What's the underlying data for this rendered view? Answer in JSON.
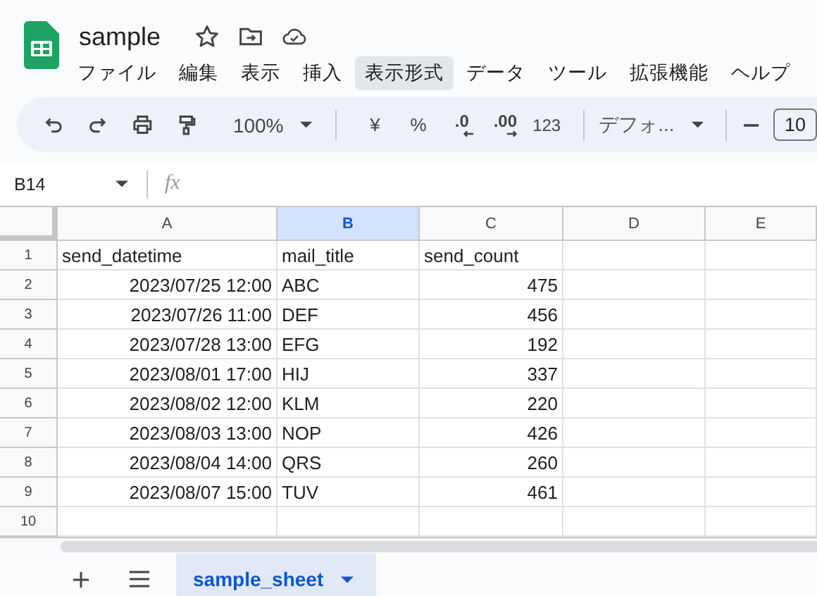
{
  "document": {
    "title": "sample"
  },
  "menu": [
    {
      "label": "ファイル",
      "highlighted": false
    },
    {
      "label": "編集",
      "highlighted": false
    },
    {
      "label": "表示",
      "highlighted": false
    },
    {
      "label": "挿入",
      "highlighted": false
    },
    {
      "label": "表示形式",
      "highlighted": true
    },
    {
      "label": "データ",
      "highlighted": false
    },
    {
      "label": "ツール",
      "highlighted": false
    },
    {
      "label": "拡張機能",
      "highlighted": false
    },
    {
      "label": "ヘルプ",
      "highlighted": false
    }
  ],
  "toolbar": {
    "zoom": "100%",
    "currency": "¥",
    "percent": "%",
    "decrease_decimals": ".0",
    "increase_decimals": ".00",
    "number_format": "123",
    "font": "デフォ...",
    "font_size": "10"
  },
  "formula_bar": {
    "cell_ref": "B14",
    "fx": "fx"
  },
  "columns": [
    {
      "label": "A",
      "selected": false
    },
    {
      "label": "B",
      "selected": true
    },
    {
      "label": "C",
      "selected": false
    },
    {
      "label": "D",
      "selected": false
    },
    {
      "label": "E",
      "selected": false
    }
  ],
  "rows": [
    {
      "number": "1",
      "cells": [
        {
          "text": "send_datetime",
          "kind": "text"
        },
        {
          "text": "mail_title",
          "kind": "text"
        },
        {
          "text": "send_count",
          "kind": "text"
        }
      ]
    },
    {
      "number": "2",
      "cells": [
        {
          "text": "2023/07/25 12:00",
          "kind": "number"
        },
        {
          "text": "ABC",
          "kind": "text"
        },
        {
          "text": "475",
          "kind": "number"
        }
      ]
    },
    {
      "number": "3",
      "cells": [
        {
          "text": "2023/07/26 11:00",
          "kind": "number"
        },
        {
          "text": "DEF",
          "kind": "text"
        },
        {
          "text": "456",
          "kind": "number"
        }
      ]
    },
    {
      "number": "4",
      "cells": [
        {
          "text": "2023/07/28 13:00",
          "kind": "number"
        },
        {
          "text": "EFG",
          "kind": "text"
        },
        {
          "text": "192",
          "kind": "number"
        }
      ]
    },
    {
      "number": "5",
      "cells": [
        {
          "text": "2023/08/01 17:00",
          "kind": "number"
        },
        {
          "text": "HIJ",
          "kind": "text"
        },
        {
          "text": "337",
          "kind": "number"
        }
      ]
    },
    {
      "number": "6",
      "cells": [
        {
          "text": "2023/08/02 12:00",
          "kind": "number"
        },
        {
          "text": "KLM",
          "kind": "text"
        },
        {
          "text": "220",
          "kind": "number"
        }
      ]
    },
    {
      "number": "7",
      "cells": [
        {
          "text": "2023/08/03 13:00",
          "kind": "number"
        },
        {
          "text": "NOP",
          "kind": "text"
        },
        {
          "text": "426",
          "kind": "number"
        }
      ]
    },
    {
      "number": "8",
      "cells": [
        {
          "text": "2023/08/04 14:00",
          "kind": "number"
        },
        {
          "text": "QRS",
          "kind": "text"
        },
        {
          "text": "260",
          "kind": "number"
        }
      ]
    },
    {
      "number": "9",
      "cells": [
        {
          "text": "2023/08/07 15:00",
          "kind": "number"
        },
        {
          "text": "TUV",
          "kind": "text"
        },
        {
          "text": "461",
          "kind": "number"
        }
      ]
    },
    {
      "number": "10",
      "cells": []
    }
  ],
  "sheet_tabs": [
    {
      "label": "sample_sheet",
      "selected": true
    }
  ]
}
